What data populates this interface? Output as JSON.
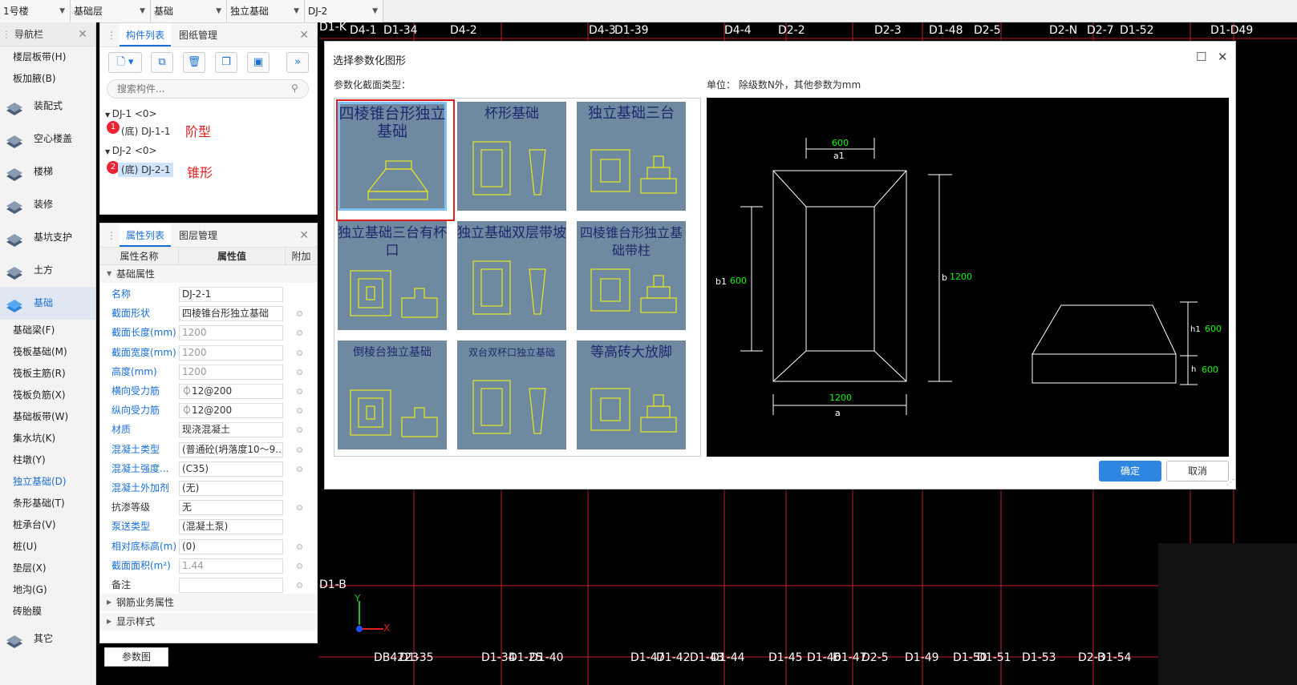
{
  "topbar": {
    "selects": [
      "1号楼",
      "基础层",
      "基础",
      "独立基础",
      "DJ-2"
    ]
  },
  "nav": {
    "title": "导航栏",
    "subs_top": [
      "楼层板带(H)",
      "板加腋(B)"
    ],
    "categories": [
      {
        "label": "装配式",
        "icon": "prefab-icon"
      },
      {
        "label": "空心楼盖",
        "icon": "hollow-floor-icon"
      },
      {
        "label": "楼梯",
        "icon": "stairs-icon"
      },
      {
        "label": "装修",
        "icon": "decoration-icon"
      },
      {
        "label": "基坑支护",
        "icon": "pit-support-icon"
      },
      {
        "label": "土方",
        "icon": "earthwork-icon"
      },
      {
        "label": "基础",
        "icon": "foundation-icon"
      }
    ],
    "foundation_items": [
      "基础梁(F)",
      "筏板基础(M)",
      "筏板主筋(R)",
      "筏板负筋(X)",
      "基础板带(W)",
      "集水坑(K)",
      "柱墩(Y)",
      "独立基础(D)",
      "条形基础(T)",
      "桩承台(V)",
      "桩(U)",
      "垫层(X)",
      "地沟(G)",
      "砖胎膜"
    ],
    "last_category": {
      "label": "其它",
      "icon": "other-icon"
    }
  },
  "components": {
    "tab_active": "构件列表",
    "tab_other": "图纸管理",
    "search_placeholder": "搜索构件...",
    "tree": [
      {
        "group": "DJ-1 <0>",
        "child": "(底) DJ-1-1",
        "badge": "1",
        "annotation": "阶型"
      },
      {
        "group": "DJ-2 <0>",
        "child": "(底) DJ-2-1",
        "badge": "2",
        "annotation": "锥形"
      }
    ]
  },
  "properties": {
    "tab_active": "属性列表",
    "tab_other": "图层管理",
    "col_name": "属性名称",
    "col_value": "属性值",
    "col_extra": "附加",
    "group_basic": "基础属性",
    "rows": [
      {
        "name": "名称",
        "value": "DJ-2-1",
        "blue": true,
        "grey": false,
        "dot": false
      },
      {
        "name": "截面形状",
        "value": "四棱锥台形独立基础",
        "blue": true,
        "grey": false,
        "dot": true
      },
      {
        "name": "截面长度(mm)",
        "value": "1200",
        "blue": true,
        "grey": true,
        "dot": true
      },
      {
        "name": "截面宽度(mm)",
        "value": "1200",
        "blue": true,
        "grey": true,
        "dot": true
      },
      {
        "name": "高度(mm)",
        "value": "1200",
        "blue": true,
        "grey": true,
        "dot": true
      },
      {
        "name": "横向受力筋",
        "value": "⏀12@200",
        "blue": true,
        "grey": false,
        "dot": true
      },
      {
        "name": "纵向受力筋",
        "value": "⏀12@200",
        "blue": true,
        "grey": false,
        "dot": true
      },
      {
        "name": "材质",
        "value": "现浇混凝土",
        "blue": true,
        "grey": false,
        "dot": true
      },
      {
        "name": "混凝土类型",
        "value": "(普通砼(坍落度10～9...",
        "blue": true,
        "grey": false,
        "dot": true
      },
      {
        "name": "混凝土强度...",
        "value": "(C35)",
        "blue": true,
        "grey": false,
        "dot": true
      },
      {
        "name": "混凝土外加剂",
        "value": "(无)",
        "blue": true,
        "grey": false,
        "dot": false
      },
      {
        "name": "抗渗等级",
        "value": "无",
        "blue": false,
        "grey": false,
        "dot": true
      },
      {
        "name": "泵送类型",
        "value": "(混凝土泵)",
        "blue": true,
        "grey": false,
        "dot": false
      },
      {
        "name": "相对底标高(m)",
        "value": "(0)",
        "blue": true,
        "grey": false,
        "dot": true
      },
      {
        "name": "截面面积(m²)",
        "value": "1.44",
        "blue": true,
        "grey": true,
        "dot": true
      },
      {
        "name": "备注",
        "value": "",
        "blue": false,
        "grey": false,
        "dot": true
      }
    ],
    "group_rebar": "钢筋业务属性",
    "group_display": "显示样式",
    "param_tab": "参数图"
  },
  "canvas": {
    "top_labels": [
      "D4-1",
      "D1-34",
      "D4-2",
      "D4-3",
      "D1-39",
      "D4-4",
      "D2-2",
      "D2-3",
      "D1-48",
      "D2-5",
      "D2-N",
      "D2-7",
      "D1-52",
      "D1-D49"
    ],
    "left_labels": [
      "D1-K",
      "D1-B"
    ],
    "bottom_labels": [
      "DB4223",
      "D1-35",
      "D1-34",
      "D1-25",
      "D1-40",
      "D1-47",
      "D1-42",
      "D1-43",
      "D1-44",
      "D1-45",
      "D1-46",
      "D1-47",
      "D2-5",
      "D1-49",
      "D1-50",
      "D1-51",
      "D1-53",
      "D2-3",
      "D1-54"
    ],
    "axis_x": "X",
    "axis_y": "Y"
  },
  "dialog": {
    "title": "选择参数化图形",
    "type_label": "参数化截面类型：",
    "unit_label": "单位： 除级数N外，其他参数为mm",
    "tiles": [
      "四棱锥台形独立基础",
      "杯形基础",
      "独立基础三台",
      "独立基础三台有杯口",
      "独立基础双层带坡",
      "四棱锥台形独立基础带柱",
      "倒棱台独立基础",
      "双台双杯口独立基础",
      "等高砖大放脚"
    ],
    "ok": "确定",
    "cancel": "取消",
    "preview": {
      "a1_label": "a1",
      "a1_value": "600",
      "b1_label": "b1",
      "b1_value": "600",
      "b_label": "b",
      "b_value": "1200",
      "a_label": "a",
      "a_value": "1200",
      "h1_label": "h1",
      "h1_value": "600",
      "h_label": "h",
      "h_value": "600"
    }
  },
  "colors": {
    "accent": "#1a6fd6",
    "selection": "#e02020",
    "tile_bg": "#6f8aa0",
    "preview_dim": "#00ff00"
  }
}
